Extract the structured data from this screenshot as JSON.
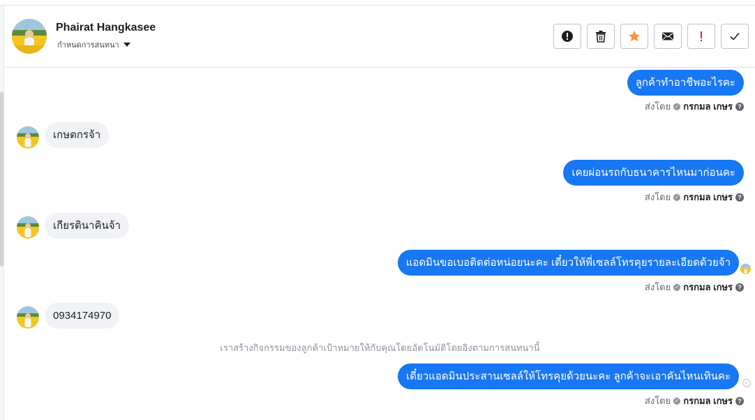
{
  "contact": {
    "name": "Phairat Hangkasee",
    "subtitle": "กำหนดการสนทนา"
  },
  "actions": [
    {
      "name": "spam-button",
      "icon": "alert-circle-icon"
    },
    {
      "name": "delete-button",
      "icon": "trash-icon"
    },
    {
      "name": "star-button",
      "icon": "star-icon"
    },
    {
      "name": "mark-unread-button",
      "icon": "envelope-icon"
    },
    {
      "name": "follow-up-button",
      "icon": "exclamation-icon"
    },
    {
      "name": "mark-done-button",
      "icon": "check-icon"
    }
  ],
  "colors": {
    "accent": "#1877f2",
    "incoming_bubble": "#f0f2f5",
    "star": "#f7923b",
    "follow_up": "#e41e3f"
  },
  "messages": {
    "m1": "ลูกค้าทำอาชีพอะไรคะ",
    "m2": "เกษตกรจ้า",
    "m3": "เคยผ่อนรถกับธนาคารไหนมาก่อนคะ",
    "m4": "เกียรตินาคินจ้า",
    "m5": "แอดมินขอเบอติดต่อหน่อยนะคะ  เดี๋ยวให้พี่เซลล์โทรคุยรายละเอียดด้วยจ้า",
    "m6": "0934174970",
    "m7": "เดี๋ยวแอดมินประสานเซลล์ให้โทรคุยด้วยนะคะ ลูกค้าจะเอาคันไหนเทินคะ"
  },
  "sent_by": {
    "prefix": "ส่งโดย",
    "agent": "กรกมล เกษร",
    "help": "?"
  },
  "system_note": "เราสร้างกิจกรรมของลูกค้าเป้าหมายให้กับคุณโดยอัตโนมัติโดยอิงตามการสนทนานี้"
}
